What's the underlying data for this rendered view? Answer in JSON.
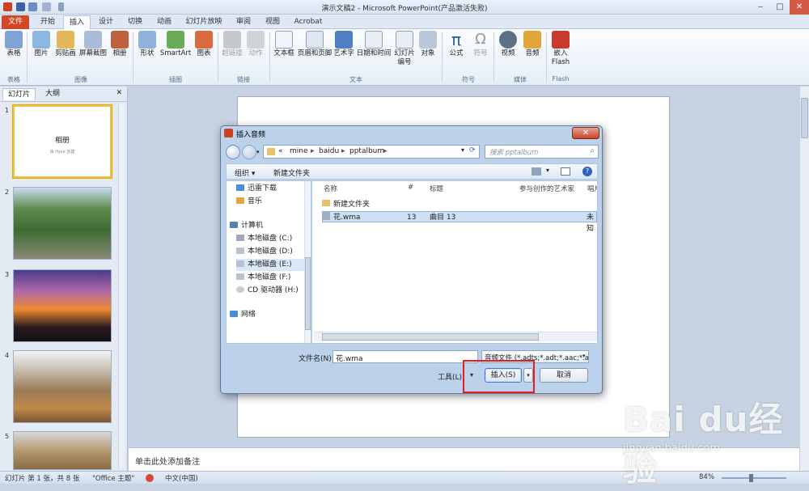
{
  "window": {
    "title": "演示文稿2 - Microsoft PowerPoint(产品激活失败)",
    "minimize": "‒",
    "maximize": "□",
    "close": "✕"
  },
  "tabs": [
    "文件",
    "开始",
    "插入",
    "设计",
    "切换",
    "动画",
    "幻灯片放映",
    "审阅",
    "视图",
    "Acrobat"
  ],
  "ribbon": {
    "table": "表格",
    "picture": "图片",
    "clipart": "剪贴画",
    "screenshot": "屏幕截图",
    "album": "相册",
    "shapes": "形状",
    "smartart": "SmartArt",
    "chart": "图表",
    "link": "超链接",
    "action": "动作",
    "textbox": "文本框",
    "header_footer": "页眉和页脚",
    "wordart": "艺术字",
    "datetime": "日期和时间",
    "slide_number": "幻灯片\n编号",
    "object": "对象",
    "equation": "公式",
    "symbol": "符号",
    "video": "视频",
    "audio": "音频",
    "embed_flash": "嵌入\nFlash",
    "groups": {
      "table": "表格",
      "image": "图像",
      "illustrations": "插图",
      "links": "链接",
      "text": "文本",
      "symbols": "符号",
      "media": "媒体",
      "flash": "Flash"
    }
  },
  "left_panel": {
    "tab_slides": "幻灯片",
    "tab_outline": "大纲",
    "close": "✕",
    "slides": [
      {
        "num": "1",
        "title": "相册",
        "subtitle": "由 Hyjie 创建"
      },
      {
        "num": "2"
      },
      {
        "num": "3"
      },
      {
        "num": "4"
      },
      {
        "num": "5"
      }
    ]
  },
  "notes_placeholder": "单击此处添加备注",
  "status": {
    "slide_info": "幻灯片 第 1 张，共 8 张",
    "theme": "\"Office 主题\"",
    "language": "中文(中国)",
    "zoom": "84%"
  },
  "dialog": {
    "title": "插入音频",
    "path": [
      "«",
      "mine",
      "baidu",
      "pptalbum"
    ],
    "search_placeholder": "搜索 pptalbum",
    "organize": "组织 ▾",
    "new_folder": "新建文件夹",
    "nav_items": [
      "迅雷下载",
      "音乐",
      "计算机",
      "本地磁盘 (C:)",
      "本地磁盘 (D:)",
      "本地磁盘 (E:)",
      "本地磁盘 (F:)",
      "CD 驱动器 (H:)",
      "网络"
    ],
    "columns": [
      "名称",
      "#",
      "标题",
      "参与创作的艺术家",
      "唱片"
    ],
    "files": [
      {
        "name": "新建文件夹",
        "num": "",
        "title": "",
        "artist": "",
        "album": ""
      },
      {
        "name": "花.wma",
        "num": "13",
        "title": "曲目 13",
        "artist": "",
        "album": "未知"
      }
    ],
    "filename_label": "文件名(N):",
    "filename_value": "花.wma",
    "filetype": "音频文件 (*.adts;*.adt;*.aac;*.a",
    "tools": "工具(L)",
    "insert": "插入(S)",
    "cancel": "取消"
  },
  "watermark": {
    "brand": "Bai du经验",
    "url": "jingyan.baidu.com"
  }
}
